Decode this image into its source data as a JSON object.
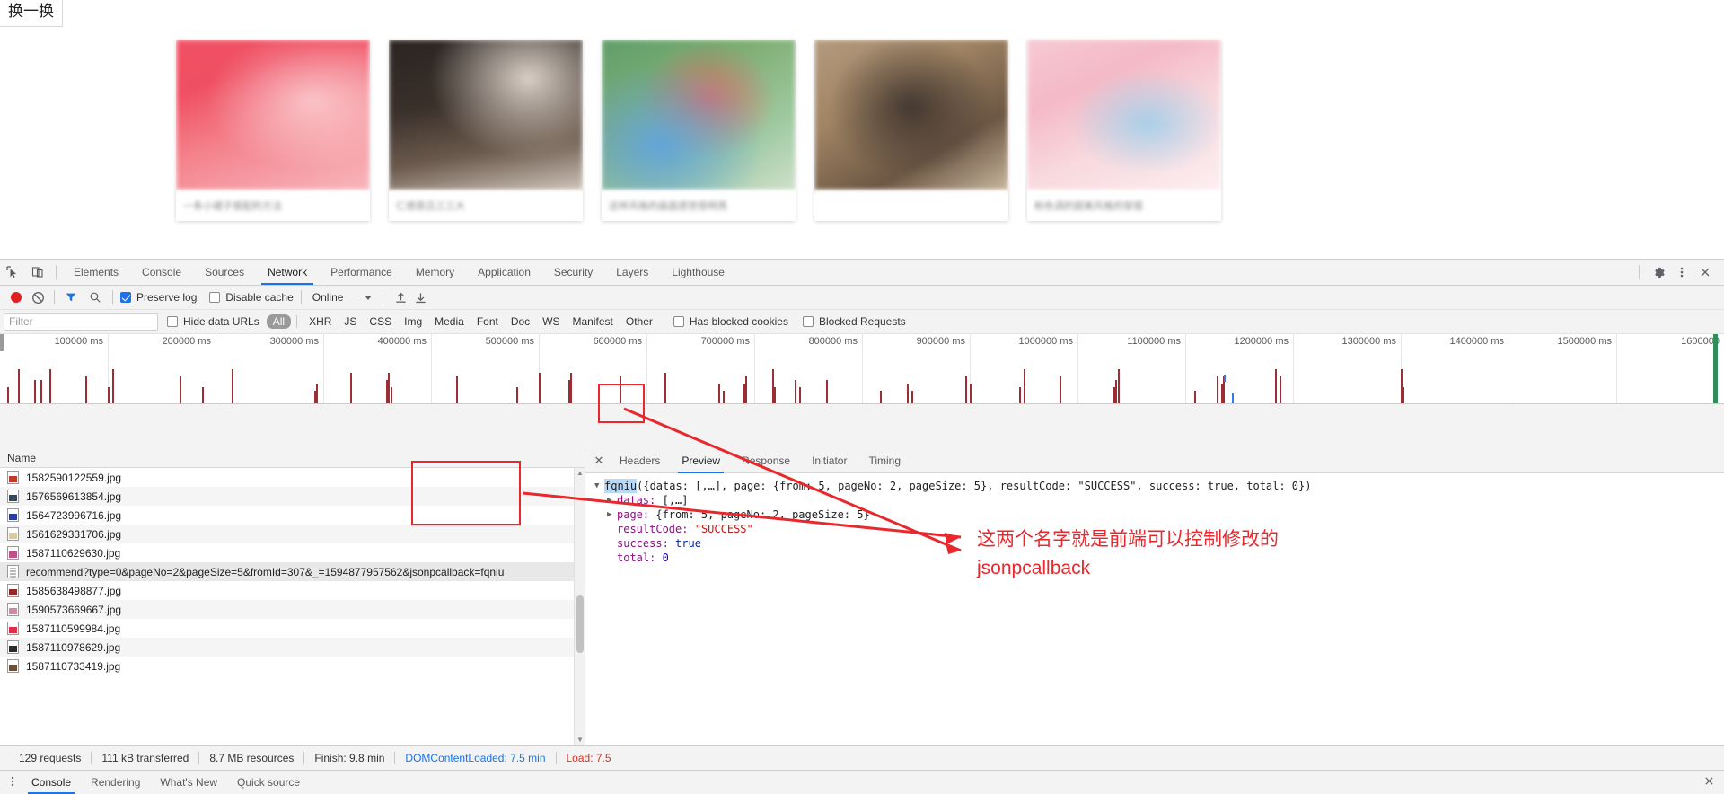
{
  "page": {
    "swap_button": "换一换",
    "cards": [
      {
        "caption": "一条小裙子搭配的方法",
        "thumb": "t1"
      },
      {
        "caption": "仁德恩吕三三大",
        "thumb": "t2"
      },
      {
        "caption": "这样风格的画面感觉很明亮",
        "thumb": "t3"
      },
      {
        "caption": "",
        "thumb": "t4"
      },
      {
        "caption": "粉色调的甜美风格的穿搭",
        "thumb": "t5"
      }
    ]
  },
  "devtools": {
    "icons": {
      "inspect": "inspect-element-icon",
      "device": "device-toolbar-icon",
      "settings": "gear-icon",
      "more": "more-vertical-icon",
      "close": "close-icon"
    },
    "tabs": [
      {
        "label": "Elements",
        "active": false
      },
      {
        "label": "Console",
        "active": false
      },
      {
        "label": "Sources",
        "active": false
      },
      {
        "label": "Network",
        "active": true
      },
      {
        "label": "Performance",
        "active": false
      },
      {
        "label": "Memory",
        "active": false
      },
      {
        "label": "Application",
        "active": false
      },
      {
        "label": "Security",
        "active": false
      },
      {
        "label": "Layers",
        "active": false
      },
      {
        "label": "Lighthouse",
        "active": false
      }
    ],
    "toolbar": {
      "record_icon": "record-stop-icon",
      "clear_icon": "clear-icon",
      "filter_icon": "funnel-icon",
      "search_icon": "search-icon",
      "preserve_log_label": "Preserve log",
      "preserve_log_checked": true,
      "disable_cache_label": "Disable cache",
      "disable_cache_checked": false,
      "throttling_value": "Online",
      "import_icon": "upload-icon",
      "export_icon": "download-icon"
    },
    "filterbar": {
      "filter_placeholder": "Filter",
      "hide_data_urls_label": "Hide data URLs",
      "hide_data_urls_checked": false,
      "types": [
        "All",
        "XHR",
        "JS",
        "CSS",
        "Img",
        "Media",
        "Font",
        "Doc",
        "WS",
        "Manifest",
        "Other"
      ],
      "active_type": "All",
      "has_blocked_cookies_label": "Has blocked cookies",
      "has_blocked_cookies_checked": false,
      "blocked_requests_label": "Blocked Requests",
      "blocked_requests_checked": false
    },
    "overview": {
      "ticks": [
        "100000 ms",
        "200000 ms",
        "300000 ms",
        "400000 ms",
        "500000 ms",
        "600000 ms",
        "700000 ms",
        "800000 ms",
        "900000 ms",
        "1000000 ms",
        "1100000 ms",
        "1200000 ms",
        "1300000 ms",
        "1400000 ms",
        "1500000 ms",
        "1600000"
      ]
    },
    "requests": {
      "column_header": "Name",
      "rows": [
        {
          "name": "1582590122559.jpg",
          "type": "img",
          "selected": false
        },
        {
          "name": "1576569613854.jpg",
          "type": "img",
          "selected": false
        },
        {
          "name": "1564723996716.jpg",
          "type": "img",
          "selected": false
        },
        {
          "name": "1561629331706.jpg",
          "type": "img",
          "selected": false
        },
        {
          "name": "1587110629630.jpg",
          "type": "img",
          "selected": false
        },
        {
          "name": "recommend?type=0&pageNo=2&pageSize=5&fromId=307&_=1594877957562&jsonpcallback=fqniu",
          "type": "doc",
          "selected": true
        },
        {
          "name": "1585638498877.jpg",
          "type": "img",
          "selected": false
        },
        {
          "name": "1590573669667.jpg",
          "type": "img",
          "selected": false
        },
        {
          "name": "1587110599984.jpg",
          "type": "img",
          "selected": false
        },
        {
          "name": "1587110978629.jpg",
          "type": "img",
          "selected": false
        },
        {
          "name": "1587110733419.jpg",
          "type": "img",
          "selected": false
        }
      ]
    },
    "details": {
      "close_label": "✕",
      "tabs": [
        {
          "label": "Headers",
          "active": false
        },
        {
          "label": "Preview",
          "active": true
        },
        {
          "label": "Response",
          "active": false
        },
        {
          "label": "Initiator",
          "active": false
        },
        {
          "label": "Timing",
          "active": false
        }
      ],
      "preview": {
        "callback_name": "fqniu",
        "line1_rest": "({datas: [,…], page: {from: 5, pageNo: 2, pageSize: 5}, resultCode: \"SUCCESS\", success: true, total: 0})",
        "line_datas_key": "datas:",
        "line_datas_val": "[,…]",
        "line_page_key": "page:",
        "line_page_val": "{from: 5, pageNo: 2, pageSize: 5}",
        "line_resultcode_key": "resultCode:",
        "line_resultcode_val": "\"SUCCESS\"",
        "line_success_key": "success:",
        "line_success_val": "true",
        "line_total_key": "total:",
        "line_total_val": "0"
      }
    },
    "summary": {
      "requests": "129 requests",
      "transferred": "111 kB transferred",
      "resources": "8.7 MB resources",
      "finish": "Finish: 9.8 min",
      "dom_content_loaded": "DOMContentLoaded: 7.5 min",
      "load": "Load: 7.5"
    },
    "drawer": {
      "menu_icon": "more-vertical-icon",
      "tabs": [
        {
          "label": "Console",
          "active": true
        },
        {
          "label": "Rendering",
          "active": false
        },
        {
          "label": "What's New",
          "active": false
        },
        {
          "label": "Quick source",
          "active": false
        }
      ],
      "close_icon": "close-icon"
    }
  },
  "annotations": {
    "color": "#e8282d",
    "note_line1": "这两个名字就是前端可以控制修改的",
    "note_line2": "jsonpcallback"
  }
}
